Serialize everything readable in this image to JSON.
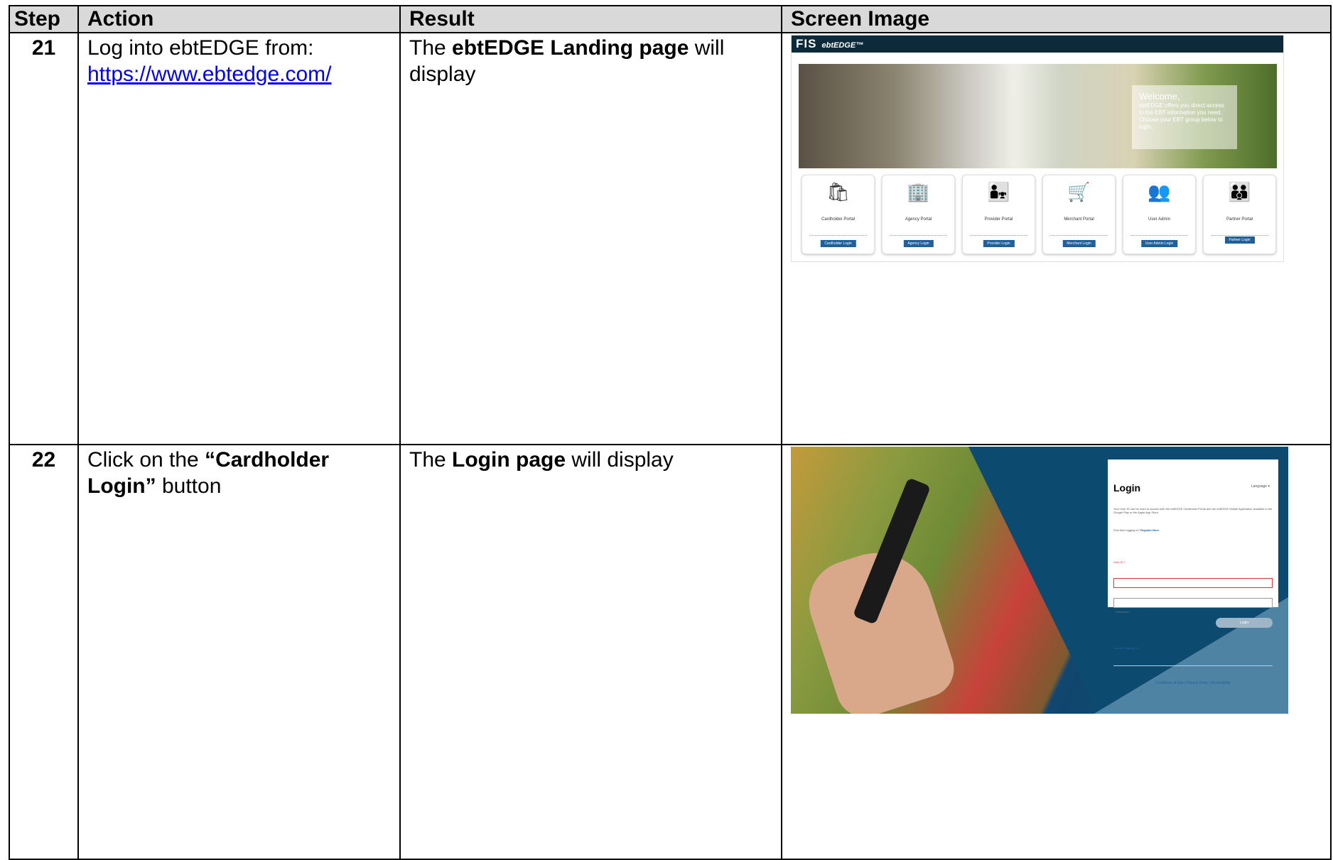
{
  "headers": {
    "step": "Step",
    "action": "Action",
    "result": "Result",
    "screen_image": "Screen Image"
  },
  "rows": [
    {
      "step": "21",
      "action_text": "Log into ebtEDGE from:",
      "action_link": "https://www.ebtedge.com/",
      "result_pre": "The ",
      "result_bold": "ebtEDGE Landing page",
      "result_post": " will display"
    },
    {
      "step": "22",
      "action_pre": "Click on the ",
      "action_bold": "“Cardholder Login”",
      "action_post": " button",
      "result_pre": "The ",
      "result_bold": "Login page",
      "result_post": " will display"
    }
  ],
  "screenshot1": {
    "logo": "FIS",
    "brand": "ebtEDGE™",
    "welcome_title": "Welcome,",
    "welcome_body": "ebtEDGE offers you direct access to the EBT information you need. Choose your EBT group below to login.",
    "cards": [
      {
        "icon": "bag-icon",
        "glyph": "🛍",
        "name": "Cardholder Portal",
        "button": "Cardholder Login"
      },
      {
        "icon": "building-icon",
        "glyph": "🏢",
        "name": "Agency Portal",
        "button": "Agency Login"
      },
      {
        "icon": "provider-icon",
        "glyph": "👨‍👧",
        "name": "Provider Portal",
        "button": "Provider Login"
      },
      {
        "icon": "cart-icon",
        "glyph": "🛒",
        "name": "Merchant Portal",
        "button": "Merchant Login"
      },
      {
        "icon": "users-icon",
        "glyph": "👥",
        "name": "User Admin",
        "button": "User Admin Login"
      },
      {
        "icon": "partner-icon",
        "glyph": "👪",
        "name": "Partner Portal",
        "button": "Partner Login"
      }
    ]
  },
  "screenshot2": {
    "language": "Language ▾",
    "title": "Login",
    "intro": "Your User ID can be used to access both the ebtEDGE Cardholder Portal and the ebtEDGE Mobile Application available in the Google Play or the Apple App Store.",
    "first_time": "First time logging in?",
    "register": "Register Here",
    "user_id_label": "User ID *",
    "password_label": "Password *",
    "login_button": "Login",
    "trouble": "Trouble Signing in?",
    "footer_links": "Conditions of Use  |  Privacy Policy  |  Accessibility"
  }
}
